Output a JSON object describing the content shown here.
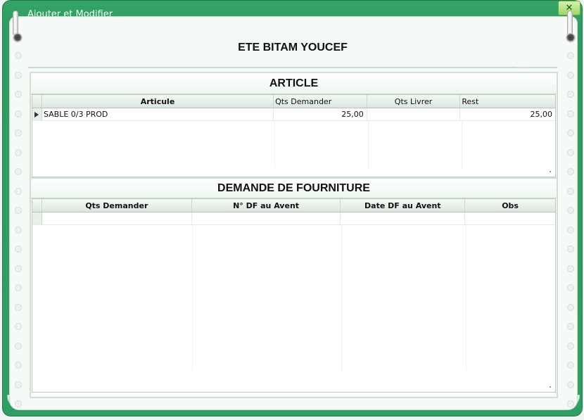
{
  "window": {
    "title": "Ajouter et Modifier",
    "close_label": "✕"
  },
  "header": {
    "title": "ETE BITAM YOUCEF"
  },
  "article": {
    "section_title": "ARTICLE",
    "columns": [
      "Articule",
      "Qts Demander",
      "Qts Livrer",
      "Rest"
    ],
    "rows": [
      {
        "articule": "SABLE 0/3 PROD",
        "qts_demander": "25,00",
        "qts_livrer": "",
        "rest": "25,00"
      }
    ]
  },
  "demande": {
    "section_title": "DEMANDE DE FOURNITURE",
    "columns": [
      "Qts Demander",
      "N° DF au Avent",
      "Date DF au Avent",
      "Obs"
    ],
    "rows": [
      {
        "qts_demander": "",
        "n_df": "",
        "date_df": "",
        "obs": ""
      }
    ]
  },
  "colors": {
    "frame": "#2e9c5f",
    "panel": "#f5faf7",
    "close_button": "#b6e383"
  },
  "icons": {
    "close": "close-icon",
    "row_pointer": "row-pointer-icon"
  }
}
